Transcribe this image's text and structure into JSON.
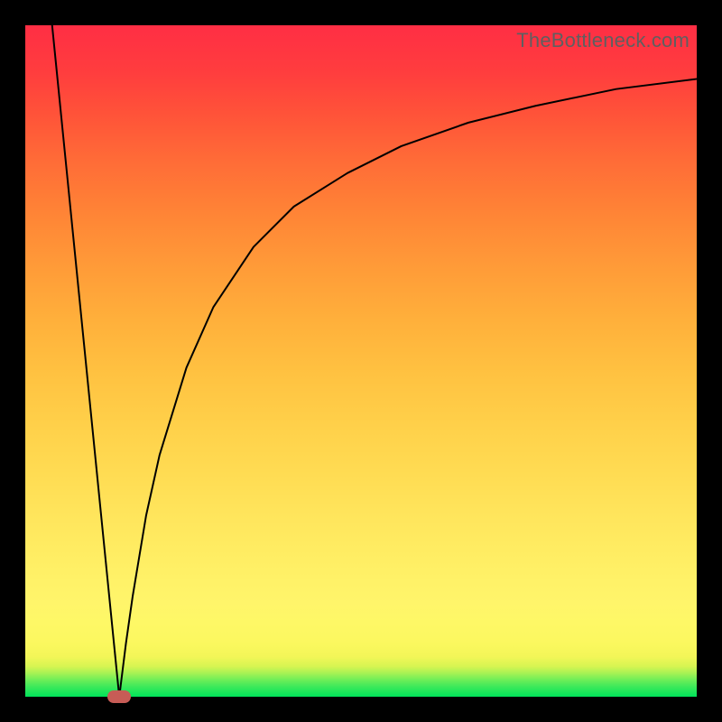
{
  "watermark": "TheBottleneck.com",
  "chart_data": {
    "type": "line",
    "title": "",
    "xlabel": "",
    "ylabel": "",
    "xlim": [
      0,
      100
    ],
    "ylim": [
      0,
      100
    ],
    "grid": false,
    "optimum_x": 14,
    "marker": {
      "x_pct": 14,
      "y_pct": 0
    },
    "series": [
      {
        "name": "left-branch",
        "x": [
          4,
          6,
          8,
          10,
          12,
          13,
          14
        ],
        "values": [
          100,
          80,
          60,
          40,
          20,
          10,
          0
        ]
      },
      {
        "name": "right-branch",
        "x": [
          14,
          15,
          16,
          18,
          20,
          24,
          28,
          34,
          40,
          48,
          56,
          66,
          76,
          88,
          100
        ],
        "values": [
          0,
          8,
          15,
          27,
          36,
          49,
          58,
          67,
          73,
          78,
          82,
          85.5,
          88,
          90.5,
          92
        ]
      }
    ],
    "background_gradient_stops": [
      {
        "pct": 0,
        "color": "#00e35a"
      },
      {
        "pct": 6,
        "color": "#f3f658"
      },
      {
        "pct": 14,
        "color": "#fff56a"
      },
      {
        "pct": 50,
        "color": "#ffc040"
      },
      {
        "pct": 80,
        "color": "#ff6b37"
      },
      {
        "pct": 100,
        "color": "#ff2e44"
      }
    ]
  }
}
